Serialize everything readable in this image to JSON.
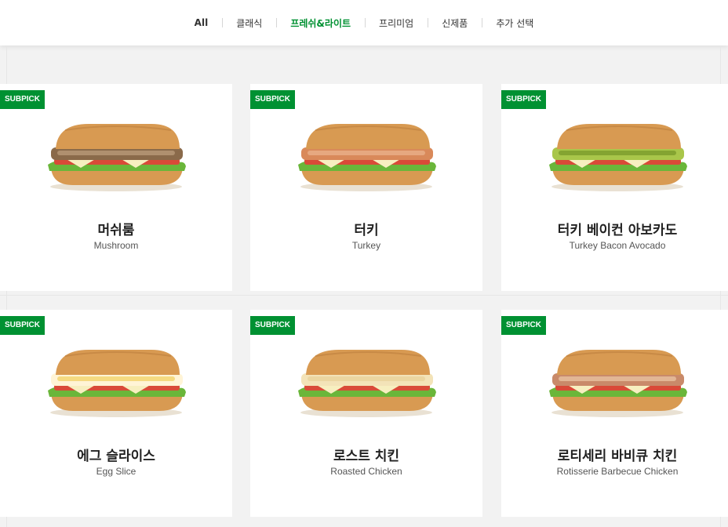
{
  "nav": {
    "tabs": [
      {
        "label": "All"
      },
      {
        "label": "클래식"
      },
      {
        "label": "프레쉬&라이트"
      },
      {
        "label": "프리미엄"
      },
      {
        "label": "신제품"
      },
      {
        "label": "추가 선택"
      }
    ],
    "active_tab": "프레쉬&라이트"
  },
  "colors": {
    "brand_green": "#009132",
    "bread": "#d89a52"
  },
  "products": [
    {
      "badge": "SUBPICK",
      "name_ko": "머쉬룸",
      "name_en": "Mushroom",
      "filling": "mushroom"
    },
    {
      "badge": "SUBPICK",
      "name_ko": "터키",
      "name_en": "Turkey",
      "filling": "turkey"
    },
    {
      "badge": "SUBPICK",
      "name_ko": "터키 베이컨 아보카도",
      "name_en": "Turkey Bacon Avocado",
      "filling": "avocado"
    },
    {
      "badge": "SUBPICK",
      "name_ko": "에그 슬라이스",
      "name_en": "Egg Slice",
      "filling": "egg"
    },
    {
      "badge": "SUBPICK",
      "name_ko": "로스트 치킨",
      "name_en": "Roasted Chicken",
      "filling": "chicken"
    },
    {
      "badge": "SUBPICK",
      "name_ko": "로티세리 바비큐 치킨",
      "name_en": "Rotisserie Barbecue Chicken",
      "filling": "bbq"
    }
  ]
}
